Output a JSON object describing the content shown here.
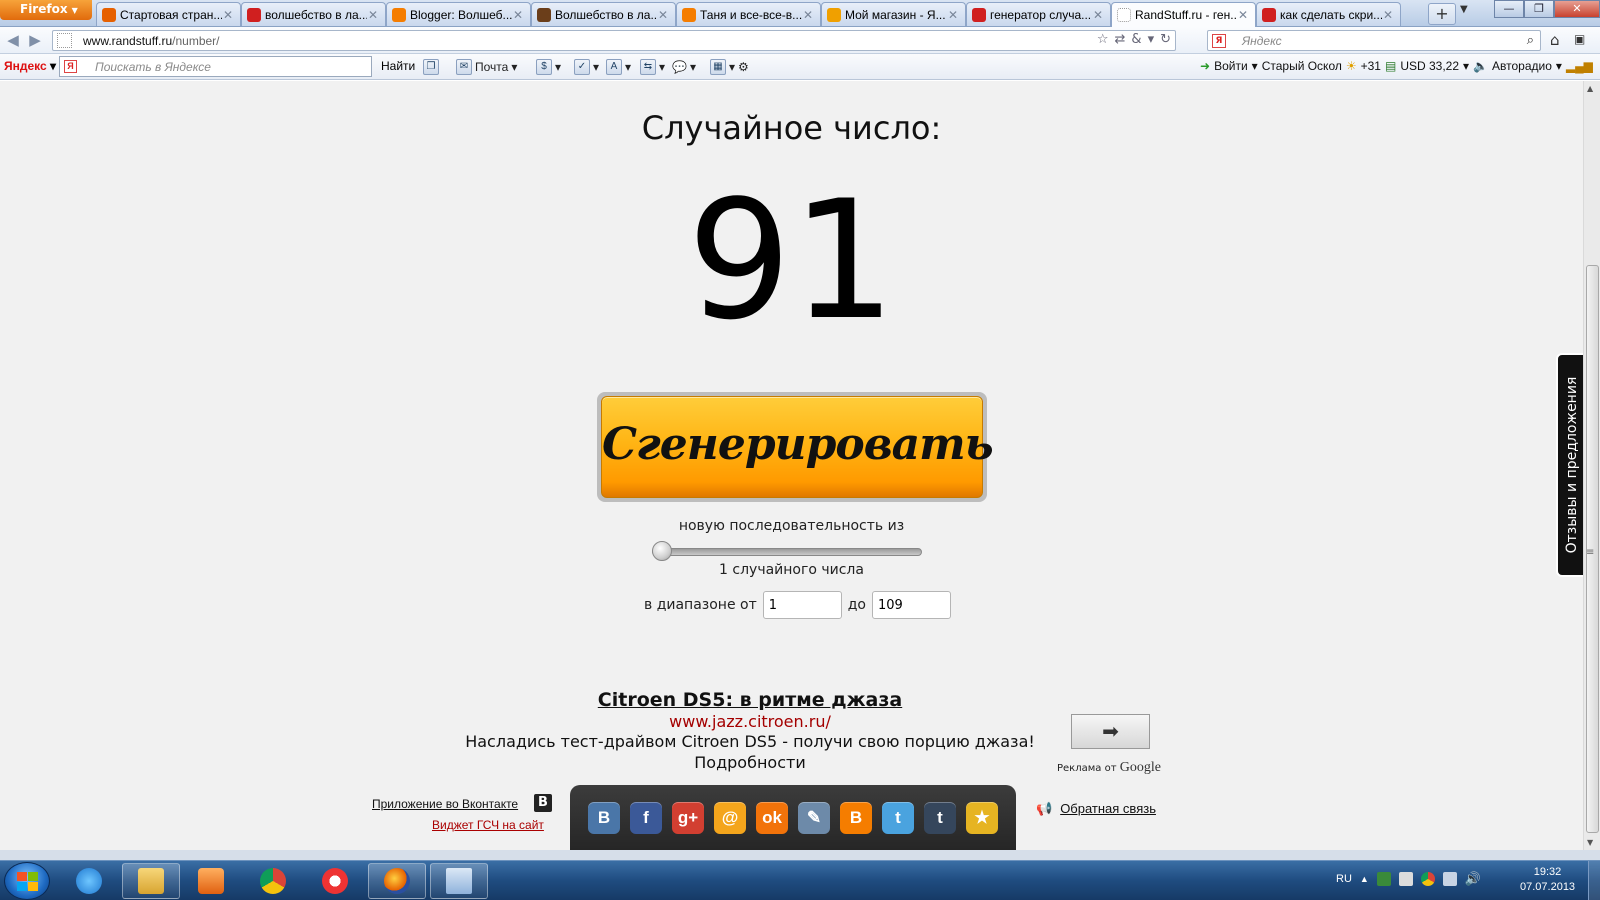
{
  "browser": {
    "menu_label": "Firefox",
    "tabs": [
      {
        "title": "Стартовая стран...",
        "icon": "firefox-icon",
        "color": "#e66000"
      },
      {
        "title": "волшебство в ла...",
        "icon": "yandex-icon",
        "color": "#d01f1f"
      },
      {
        "title": "Blogger: Волшеб...",
        "icon": "blogger-icon",
        "color": "#f57d00"
      },
      {
        "title": "Волшебство в ла...",
        "icon": "image-icon",
        "color": "#6b3e1a"
      },
      {
        "title": "Таня и все-все-в...",
        "icon": "blogger-icon",
        "color": "#f57d00"
      },
      {
        "title": "Мой магазин - Я...",
        "icon": "ring-icon",
        "color": "#f0a000"
      },
      {
        "title": "генератор случа...",
        "icon": "yandex-icon",
        "color": "#d01f1f"
      },
      {
        "title": "RandStuff.ru - ген...",
        "icon": "blank-page-icon",
        "color": "#ffffff",
        "active": true
      },
      {
        "title": "как сделать скри...",
        "icon": "yandex-icon",
        "color": "#d01f1f"
      }
    ],
    "url_host": "www.randstuff.ru",
    "url_path": "/number/",
    "search_placeholder": "Яндекс"
  },
  "yandex_bar": {
    "brand": "Яндекс",
    "search_placeholder": "Поискать в Яндексе",
    "find_label": "Найти",
    "mail_label": "Почта",
    "login_label": "Войти",
    "city": "Старый Оскол",
    "weather": "+31",
    "currency": "USD 33,22",
    "radio": "Авторадио"
  },
  "page": {
    "heading": "Случайное число:",
    "number": "91",
    "generate_label": "Сгенерировать",
    "sequence_label": "новую последовательность из",
    "count_label": "1 случайного числа",
    "range_from_label": "в диапазоне от",
    "range_from_value": "1",
    "range_to_label": "до",
    "range_to_value": "109",
    "slider_value": 1
  },
  "ad": {
    "title": "Citroen DS5: в ритме джаза",
    "url": "www.jazz.citroen.ru/",
    "text": "Насладись тест-драйвом Citroen DS5 - получи свою порцию джаза!",
    "more": "Подробности",
    "by_label": "Реклама от",
    "by_brand": "Google"
  },
  "footer": {
    "vk_app": "Приложение во Вконтакте",
    "widget": "Виджет ГСЧ на сайт",
    "feedback": "Обратная связь",
    "side_tab": "Отзывы и предложения",
    "social": [
      {
        "name": "vkontakte-icon",
        "glyph": "B",
        "color": "#4a76a8"
      },
      {
        "name": "facebook-icon",
        "glyph": "f",
        "color": "#3b5998"
      },
      {
        "name": "google-plus-icon",
        "glyph": "g+",
        "color": "#d23f31"
      },
      {
        "name": "mail-ru-icon",
        "glyph": "@",
        "color": "#f4a51c"
      },
      {
        "name": "odnoklassniki-icon",
        "glyph": "ok",
        "color": "#f2730a"
      },
      {
        "name": "livejournal-icon",
        "glyph": "✎",
        "color": "#6d8aa9"
      },
      {
        "name": "blogger-icon",
        "glyph": "B",
        "color": "#f57d00"
      },
      {
        "name": "twitter-icon",
        "glyph": "t",
        "color": "#4aa3df"
      },
      {
        "name": "tumblr-icon",
        "glyph": "t",
        "color": "#35465c"
      },
      {
        "name": "favorites-star-icon",
        "glyph": "★",
        "color": "#e6b422"
      }
    ]
  },
  "taskbar": {
    "lang": "RU",
    "time": "19:32",
    "date": "07.07.2013"
  }
}
